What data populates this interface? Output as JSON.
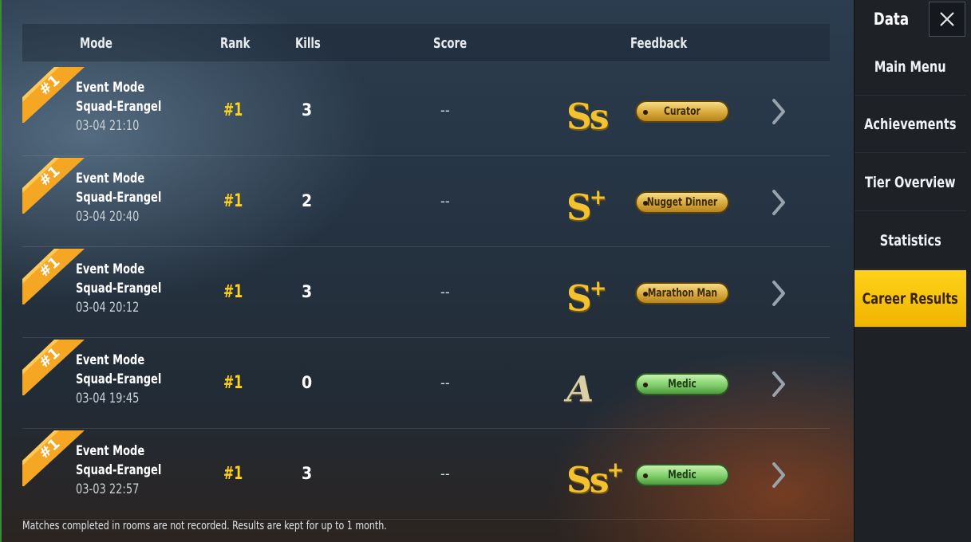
{
  "header": {
    "mode": "Mode",
    "rank": "Rank",
    "kills": "Kills",
    "score": "Score",
    "feedback": "Feedback"
  },
  "rows": [
    {
      "ribbon": "#1",
      "mode": "Event Mode",
      "map": "Squad-Erangel",
      "date": "03-04 21:10",
      "rank": "#1",
      "kills": "3",
      "score": "--",
      "grade": "Ss",
      "grade_plus": "",
      "feedback": "Curator",
      "feedback_style": "gold"
    },
    {
      "ribbon": "#1",
      "mode": "Event Mode",
      "map": "Squad-Erangel",
      "date": "03-04 20:40",
      "rank": "#1",
      "kills": "2",
      "score": "--",
      "grade": "S",
      "grade_plus": "+",
      "feedback": "Nugget Dinner",
      "feedback_style": "gold"
    },
    {
      "ribbon": "#1",
      "mode": "Event Mode",
      "map": "Squad-Erangel",
      "date": "03-04 20:12",
      "rank": "#1",
      "kills": "3",
      "score": "--",
      "grade": "S",
      "grade_plus": "+",
      "feedback": "Marathon Man",
      "feedback_style": "gold"
    },
    {
      "ribbon": "#1",
      "mode": "Event Mode",
      "map": "Squad-Erangel",
      "date": "03-04 19:45",
      "rank": "#1",
      "kills": "0",
      "score": "--",
      "grade": "A",
      "grade_plus": "",
      "feedback": "Medic",
      "feedback_style": "green"
    },
    {
      "ribbon": "#1",
      "mode": "Event Mode",
      "map": "Squad-Erangel",
      "date": "03-03 22:57",
      "rank": "#1",
      "kills": "3",
      "score": "--",
      "grade": "Ss",
      "grade_plus": "+",
      "feedback": "Medic",
      "feedback_style": "green"
    }
  ],
  "footnote": "Matches completed in rooms are not recorded. Results are kept for up to 1 month.",
  "sidebar": {
    "title": "Data",
    "items": [
      {
        "label": "Main Menu",
        "active": false
      },
      {
        "label": "Achievements",
        "active": false
      },
      {
        "label": "Tier Overview",
        "active": false
      },
      {
        "label": "Statistics",
        "active": false
      },
      {
        "label": "Career Results",
        "active": true
      }
    ]
  },
  "colors": {
    "accent": "#ffd21a",
    "rank": "#ffd21a",
    "ribbon": "#f5a623"
  },
  "icons": {
    "close": "close-icon",
    "row_arrow": "chevron-right-icon",
    "ribbon": "rank-ribbon-icon"
  }
}
